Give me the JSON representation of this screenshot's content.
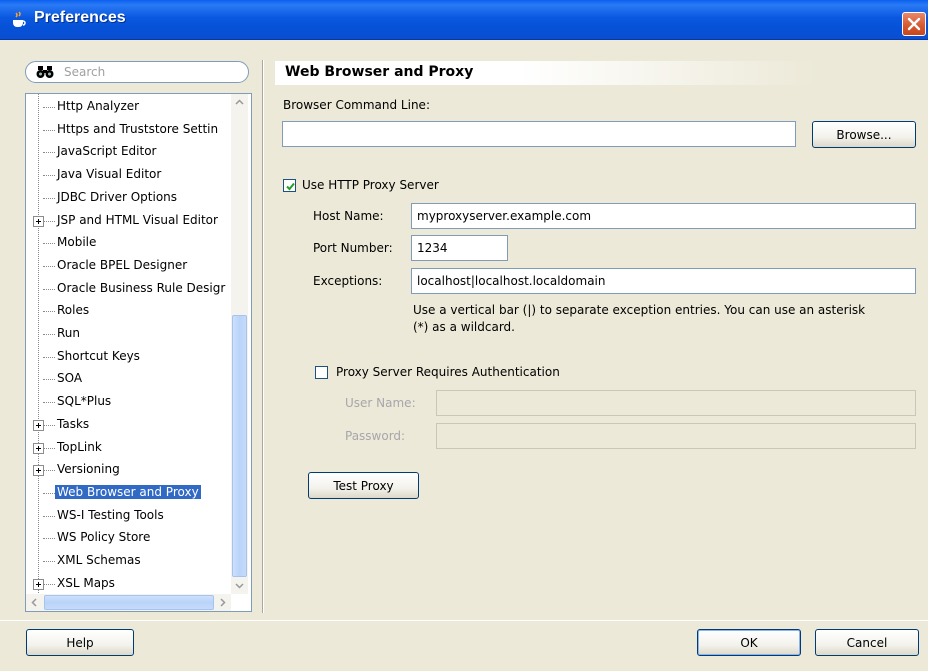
{
  "window": {
    "title": "Preferences"
  },
  "search": {
    "placeholder": "Search"
  },
  "tree": {
    "items": [
      {
        "label": "Http Analyzer",
        "expandable": false,
        "selected": false
      },
      {
        "label": "Https and Truststore Settin",
        "expandable": false,
        "selected": false
      },
      {
        "label": "JavaScript Editor",
        "expandable": false,
        "selected": false
      },
      {
        "label": "Java Visual Editor",
        "expandable": false,
        "selected": false
      },
      {
        "label": "JDBC Driver Options",
        "expandable": false,
        "selected": false
      },
      {
        "label": "JSP and HTML Visual Editor",
        "expandable": true,
        "selected": false
      },
      {
        "label": "Mobile",
        "expandable": false,
        "selected": false
      },
      {
        "label": "Oracle BPEL Designer",
        "expandable": false,
        "selected": false
      },
      {
        "label": "Oracle Business Rule Desigr",
        "expandable": false,
        "selected": false
      },
      {
        "label": "Roles",
        "expandable": false,
        "selected": false
      },
      {
        "label": "Run",
        "expandable": false,
        "selected": false
      },
      {
        "label": "Shortcut Keys",
        "expandable": false,
        "selected": false
      },
      {
        "label": "SOA",
        "expandable": false,
        "selected": false
      },
      {
        "label": "SQL*Plus",
        "expandable": false,
        "selected": false
      },
      {
        "label": "Tasks",
        "expandable": true,
        "selected": false
      },
      {
        "label": "TopLink",
        "expandable": true,
        "selected": false
      },
      {
        "label": "Versioning",
        "expandable": true,
        "selected": false
      },
      {
        "label": "Web Browser and Proxy",
        "expandable": false,
        "selected": true
      },
      {
        "label": "WS-I Testing Tools",
        "expandable": false,
        "selected": false
      },
      {
        "label": "WS Policy Store",
        "expandable": false,
        "selected": false
      },
      {
        "label": "XML Schemas",
        "expandable": false,
        "selected": false
      },
      {
        "label": "XSL Maps",
        "expandable": true,
        "selected": false
      }
    ]
  },
  "panel": {
    "title": "Web Browser and Proxy",
    "browser_command_line_label": "Browser Command Line:",
    "browser_command_line_value": "",
    "browse_button": "Browse...",
    "use_proxy_label": "Use HTTP Proxy Server",
    "use_proxy_checked": true,
    "host_name_label": "Host Name:",
    "host_name_value": "myproxyserver.example.com",
    "port_number_label": "Port Number:",
    "port_number_value": "1234",
    "exceptions_label": "Exceptions:",
    "exceptions_value": "localhost|localhost.localdomain",
    "exceptions_help_line1": "Use a vertical bar (|) to separate exception entries.  You can use an asterisk",
    "exceptions_help_line2": "(*) as a wildcard.",
    "auth_label": "Proxy Server Requires Authentication",
    "auth_checked": false,
    "user_name_label": "User Name:",
    "user_name_value": "",
    "password_label": "Password:",
    "password_value": "",
    "test_proxy_button": "Test Proxy"
  },
  "footer": {
    "help_button": "Help",
    "ok_button": "OK",
    "cancel_button": "Cancel"
  },
  "colors": {
    "title_bar": "#0b58e0",
    "selection": "#316ac5",
    "dialog_bg": "#ece9d8"
  }
}
